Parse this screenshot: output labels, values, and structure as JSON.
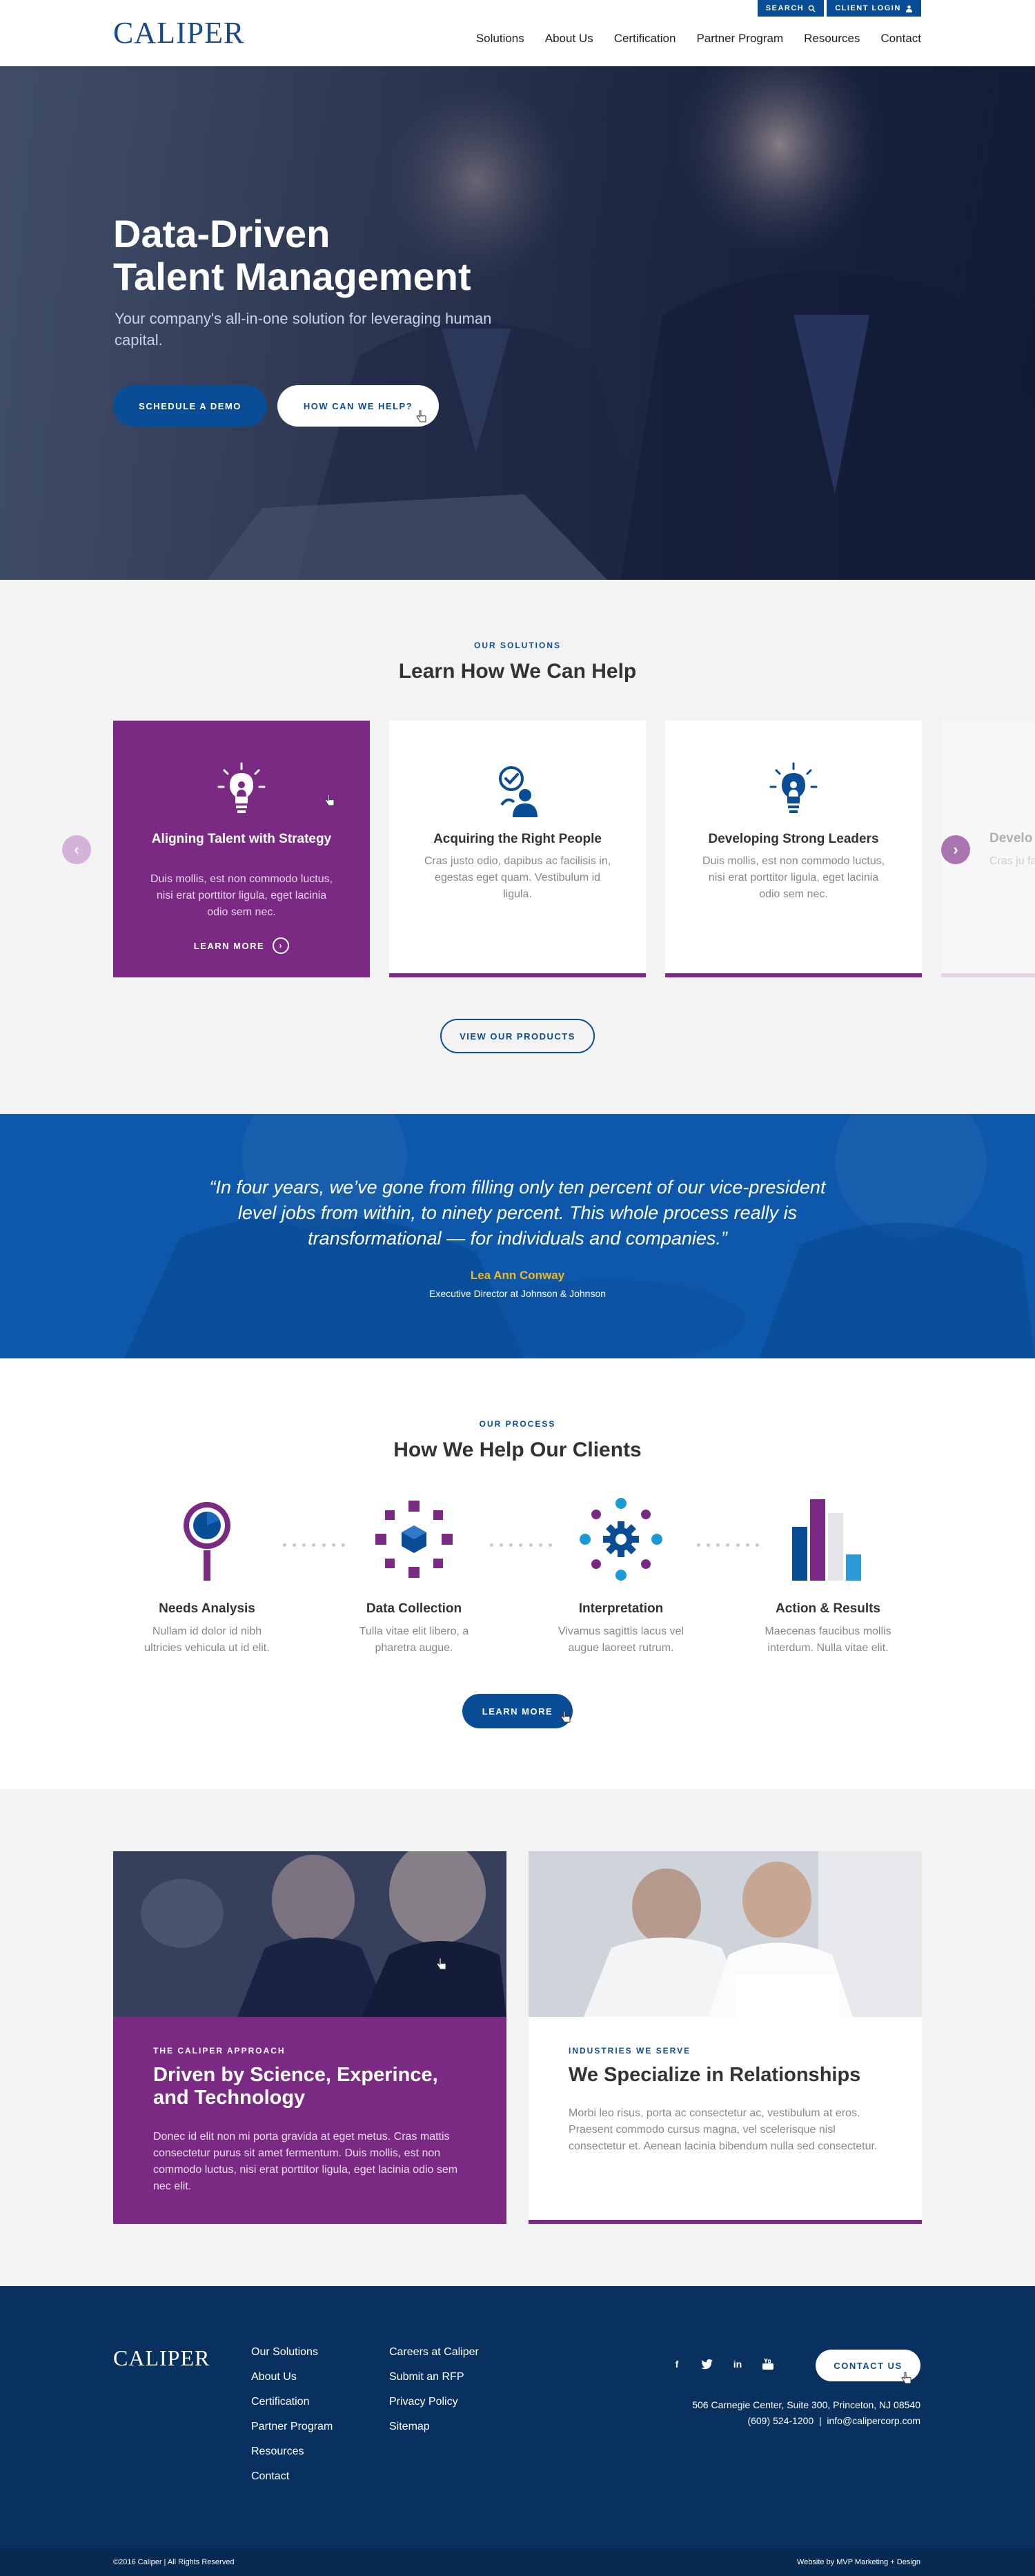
{
  "header": {
    "logo": "CALIPER",
    "search_label": "SEARCH",
    "login_label": "CLIENT LOGIN",
    "nav": [
      "Solutions",
      "About Us",
      "Certification",
      "Partner Program",
      "Resources",
      "Contact"
    ]
  },
  "hero": {
    "title_line1": "Data-Driven",
    "title_line2": "Talent Management",
    "subtitle": "Your company's all-in-one solution for leveraging human capital.",
    "primary_button": "SCHEDULE A DEMO",
    "secondary_button": "HOW CAN WE HELP?"
  },
  "solutions": {
    "eyebrow": "OUR SOLUTIONS",
    "title": "Learn How We Can Help",
    "cards": [
      {
        "title": "Aligning Talent with Strategy",
        "text": "Duis mollis, est non commodo luctus, nisi erat porttitor ligula, eget lacinia odio sem nec.",
        "link": "LEARN MORE",
        "icon": "lightbulb-icon"
      },
      {
        "title": "Acquiring the Right People",
        "text": "Cras justo odio, dapibus ac facilisis in, egestas eget quam. Vestibulum id ligula.",
        "icon": "people-check-icon"
      },
      {
        "title": "Developing Strong Leaders",
        "text": "Duis mollis, est non commodo luctus, nisi erat porttitor ligula, eget lacinia odio sem nec.",
        "icon": "lightbulb-person-icon"
      },
      {
        "title": "Develo",
        "text": "Cras ju facilisis in."
      }
    ],
    "button": "VIEW OUR PRODUCTS"
  },
  "quote": {
    "text": "“In four years, we’ve gone from filling only ten percent of our vice-president level jobs from within, to ninety percent. This whole process really is transformational — for individuals and companies.”",
    "name": "Lea Ann Conway",
    "role": "Executive Director at Johnson & Johnson"
  },
  "process": {
    "eyebrow": "OUR PROCESS",
    "title": "How We Help Our Clients",
    "steps": [
      {
        "title": "Needs Analysis",
        "text": "Nullam id dolor id nibh ultricies vehicula ut id elit."
      },
      {
        "title": "Data Collection",
        "text": "Tulla vitae elit libero, a pharetra augue."
      },
      {
        "title": "Interpretation",
        "text": "Vivamus sagittis lacus vel augue laoreet rutrum."
      },
      {
        "title": "Action & Results",
        "text": "Maecenas faucibus mollis interdum. Nulla vitae elit."
      }
    ],
    "button": "LEARN MORE"
  },
  "features": {
    "left": {
      "eyebrow": "THE CALIPER APPROACH",
      "title": "Driven by Science, Experince, and Technology",
      "text": "Donec id elit non mi porta gravida at eget metus. Cras mattis consectetur purus sit amet fermentum. Duis mollis, est non commodo luctus, nisi erat porttitor ligula, eget lacinia odio sem nec elit."
    },
    "right": {
      "eyebrow": "INDUSTRIES WE SERVE",
      "title": "We Specialize in Relationships",
      "text": "Morbi leo risus, porta ac consectetur ac, vestibulum at eros. Praesent commodo cursus magna, vel scelerisque nisl consectetur et. Aenean lacinia bibendum nulla sed consectetur."
    }
  },
  "footer": {
    "logo": "CALIPER",
    "col1": [
      "Our Solutions",
      "About Us",
      "Certification",
      "Partner Program",
      "Resources",
      "Contact"
    ],
    "col2": [
      "Careers at Caliper",
      "Submit an RFP",
      "Privacy  Policy",
      "Sitemap"
    ],
    "social": [
      "f",
      "t",
      "in",
      "yt"
    ],
    "contact_button": "CONTACT US",
    "address": "506 Carnegie Center, Suite 300, Princeton, NJ 08540",
    "phone": "(609) 524-1200",
    "email": "info@calipercorp.com",
    "copyright": "©2016 Caliper | All Rights Reserved",
    "credit": "Website by MVP Marketing + Design"
  },
  "colors": {
    "brand_blue": "#0a4d97",
    "purple": "#7b2a84",
    "footer_navy": "#08315f",
    "quote_gold": "#f2b81f"
  }
}
